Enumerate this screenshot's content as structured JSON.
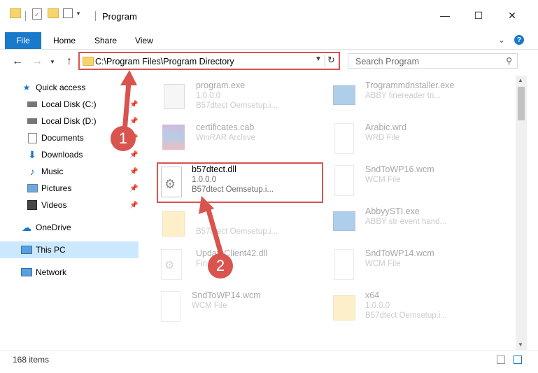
{
  "window": {
    "title": "Program",
    "minimize_glyph": "—",
    "maximize_glyph": "☐",
    "close_glyph": "✕"
  },
  "ribbon": {
    "tabs": [
      "File",
      "Home",
      "Share",
      "View"
    ],
    "accent": "#1979ca",
    "help_label": "?"
  },
  "address": {
    "path": "C:\\Program Files\\Program Directory",
    "highlight_color": "#d9534f"
  },
  "search": {
    "placeholder": "Search Program"
  },
  "sidebar": {
    "items": [
      {
        "label": "Quick access",
        "icon": "star-icon",
        "pinned": false
      },
      {
        "label": "Local Disk (C:)",
        "icon": "drive-icon",
        "pinned": true
      },
      {
        "label": "Local Disk (D:)",
        "icon": "drive-icon",
        "pinned": true
      },
      {
        "label": "Documents",
        "icon": "documents-icon",
        "pinned": true
      },
      {
        "label": "Downloads",
        "icon": "download-icon",
        "pinned": true
      },
      {
        "label": "Music",
        "icon": "music-icon",
        "pinned": true
      },
      {
        "label": "Pictures",
        "icon": "pictures-icon",
        "pinned": true
      },
      {
        "label": "Videos",
        "icon": "videos-icon",
        "pinned": true
      },
      {
        "label": "OneDrive",
        "icon": "cloud-icon",
        "pinned": false
      },
      {
        "label": "This PC",
        "icon": "computer-icon",
        "pinned": false,
        "selected": true
      },
      {
        "label": "Network",
        "icon": "network-icon",
        "pinned": false
      }
    ]
  },
  "files": [
    {
      "name": "program.exe",
      "line2": "1.0.0.0",
      "line3": "B57dtect Oemsetup.i...",
      "icon": "exe-icon",
      "faded": true
    },
    {
      "name": "Trogrammdnstaller.exe",
      "line2": "ABBY finereader tri...",
      "line3": "",
      "icon": "exe-icon",
      "faded": true
    },
    {
      "name": "certificates.cab",
      "line2": "WinRAR Archive",
      "line3": "",
      "icon": "archive-icon",
      "faded": true
    },
    {
      "name": "Arabic.wrd",
      "line2": "WRD File",
      "line3": "",
      "icon": "file-icon",
      "faded": true
    },
    {
      "name": "b57dtect.dll",
      "line2": "1.0.0.0",
      "line3": "B57dtect Oemsetup.i...",
      "icon": "dll-gear-icon",
      "faded": false
    },
    {
      "name": "SndToWP16.wcm",
      "line2": "WCM File",
      "line3": "",
      "icon": "file-icon",
      "faded": true
    },
    {
      "name": "",
      "line2": "",
      "line3": "B57dtect Oemsetup.i...",
      "icon": "folder-icon",
      "faded": true
    },
    {
      "name": "AbbyySTI.exe",
      "line2": "ABBY str event hand...",
      "line3": "",
      "icon": "exe-icon",
      "faded": true
    },
    {
      "name": "UpdateClient42.dll",
      "line2": "Fin...LL",
      "line3": "",
      "icon": "dll-gear-icon",
      "faded": true
    },
    {
      "name": "SndToWP14.wcm",
      "line2": "WCM File",
      "line3": "",
      "icon": "file-icon",
      "faded": true
    },
    {
      "name": "SndToWP14.wcm",
      "line2": "WCM File",
      "line3": "",
      "icon": "file-icon",
      "faded": true
    },
    {
      "name": "x64",
      "line2": "1.0.0.0",
      "line3": "B57dtect Oemsetup.i...",
      "icon": "folder-icon",
      "faded": true
    }
  ],
  "status": {
    "items_count": "168 items"
  },
  "callouts": [
    "1",
    "2"
  ]
}
